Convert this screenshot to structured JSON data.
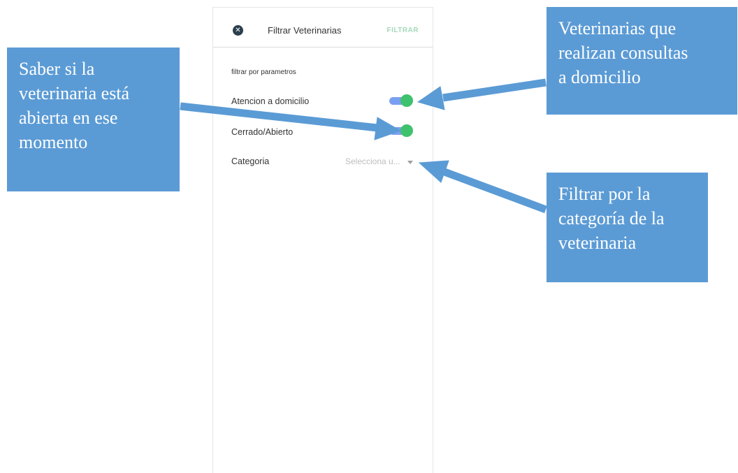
{
  "header": {
    "close_glyph": "✕",
    "title": "Filtrar Veterinarias",
    "action_label": "FILTRAR"
  },
  "filters": {
    "section_label": "filtrar por parametros",
    "home_service": {
      "label": "Atencion a domicilio",
      "enabled": true
    },
    "open_closed": {
      "label": "Cerrado/Abierto",
      "enabled": true
    },
    "category": {
      "label": "Categoria",
      "placeholder": "Selecciona u..."
    }
  },
  "annotations": {
    "open_now": "Saber si la\nveterinaria está\nabierta en ese\nmomento",
    "home_consults": "Veterinarias que\nrealizan consultas\na domicilio",
    "category_filter": "Filtrar por la\ncategoría de la\nveterinaria"
  },
  "colors": {
    "callout_bg": "#5b9bd5",
    "toggle_track": "#7b9ff0",
    "toggle_knob": "#3fc26d",
    "filter_action": "#a5d9b9",
    "close_button": "#2b3f4c"
  },
  "icons": {
    "close": "close-icon",
    "dropdown": "chevron-down-icon"
  }
}
